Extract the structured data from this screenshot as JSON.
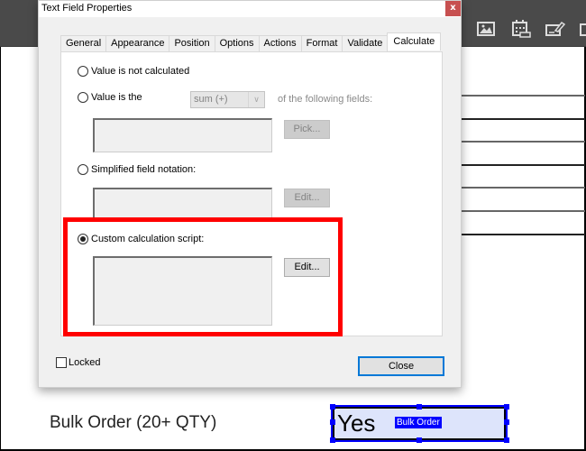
{
  "app": {
    "toolbar_icons": [
      "image-icon",
      "calendar-date-icon",
      "signature-icon",
      "partial-icon"
    ]
  },
  "document": {
    "bulk_label": "Bulk Order (20+ QTY)",
    "bulk_field_value": "Yes",
    "bulk_field_name": "Bulk Order",
    "field_highlight_color": "#dde4fb",
    "selection_color": "#0000ff"
  },
  "dialog": {
    "title": "Text Field Properties",
    "close_glyph": "x",
    "tabs": [
      {
        "label": "General",
        "active": false
      },
      {
        "label": "Appearance",
        "active": false
      },
      {
        "label": "Position",
        "active": false
      },
      {
        "label": "Options",
        "active": false
      },
      {
        "label": "Actions",
        "active": false
      },
      {
        "label": "Format",
        "active": false
      },
      {
        "label": "Validate",
        "active": false
      },
      {
        "label": "Calculate",
        "active": true
      }
    ],
    "calculate": {
      "options": [
        {
          "label": "Value is not calculated",
          "checked": false
        },
        {
          "label": "Value is the",
          "checked": false
        },
        {
          "label": "Simplified field notation:",
          "checked": false
        },
        {
          "label": "Custom calculation script:",
          "checked": true
        }
      ],
      "operation_select": {
        "value": "sum (+)",
        "disabled": true
      },
      "following_fields_label": "of the following fields:",
      "pick_button": "Pick...",
      "simplified_edit_button": "Edit...",
      "custom_edit_button": "Edit...",
      "fields_value": "",
      "simplified_value": "",
      "custom_script_value": ""
    },
    "locked_label": "Locked",
    "locked_checked": false,
    "close_button": "Close",
    "highlight_color": "#ff0000"
  }
}
